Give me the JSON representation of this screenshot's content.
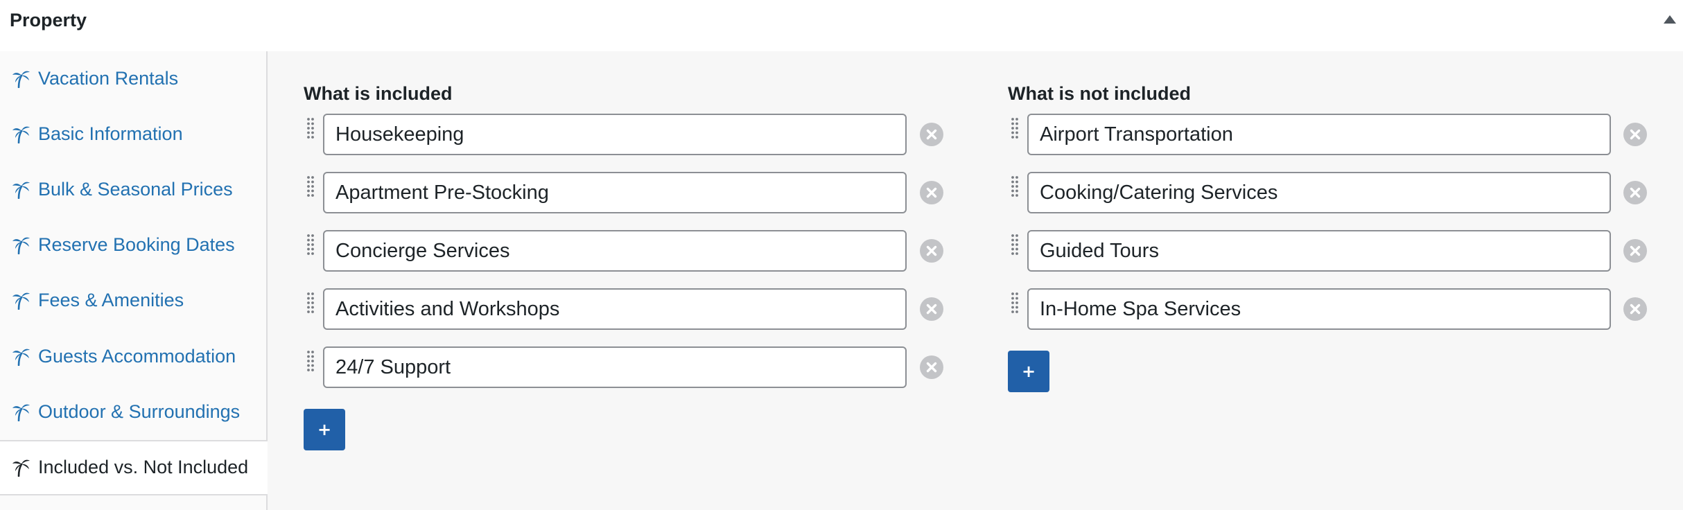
{
  "panel": {
    "title": "Property"
  },
  "sidebar": {
    "items": [
      {
        "label": "Vacation Rentals",
        "active": false
      },
      {
        "label": "Basic Information",
        "active": false
      },
      {
        "label": "Bulk & Seasonal Prices",
        "active": false
      },
      {
        "label": "Reserve Booking Dates",
        "active": false
      },
      {
        "label": "Fees & Amenities",
        "active": false
      },
      {
        "label": "Guests Accommodation",
        "active": false
      },
      {
        "label": "Outdoor & Surroundings",
        "active": false
      },
      {
        "label": "Included vs. Not Included",
        "active": true
      }
    ],
    "icon": "palm-tree-icon"
  },
  "included": {
    "heading": "What is included",
    "items": [
      {
        "value": "Housekeeping"
      },
      {
        "value": "Apartment Pre-Stocking"
      },
      {
        "value": "Concierge Services"
      },
      {
        "value": "Activities and Workshops"
      },
      {
        "value": "24/7 Support"
      }
    ],
    "add_label": "+"
  },
  "not_included": {
    "heading": "What is not included",
    "items": [
      {
        "value": "Airport Transportation"
      },
      {
        "value": "Cooking/Catering Services"
      },
      {
        "value": "Guided Tours"
      },
      {
        "value": "In-Home Spa Services"
      }
    ],
    "add_label": "+"
  },
  "colors": {
    "link": "#2271b1",
    "button": "#2160a8",
    "remove": "#c3c4c7"
  }
}
